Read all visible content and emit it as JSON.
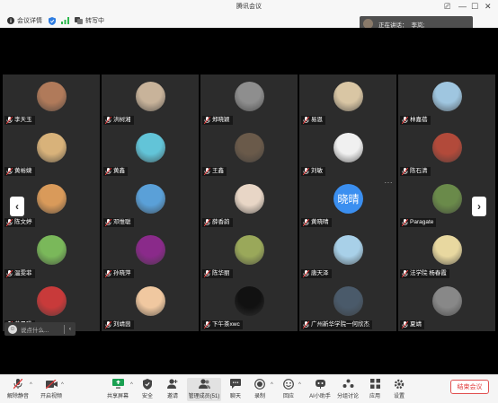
{
  "app_title": "腾讯会议",
  "infobar": {
    "meeting_details": "会议详情",
    "recording": "转写中"
  },
  "speaking": {
    "label": "正在讲话：",
    "speaker": "李岚;"
  },
  "participants": [
    {
      "name": "李天玉"
    },
    {
      "name": "洪树湘"
    },
    {
      "name": "郑晓颖"
    },
    {
      "name": "易恩"
    },
    {
      "name": "林嘉蓓"
    },
    {
      "name": "黄裕婕"
    },
    {
      "name": "黄鑫"
    },
    {
      "name": "王鑫"
    },
    {
      "name": "刘敏"
    },
    {
      "name": "陈石清"
    },
    {
      "name": "陈文婷"
    },
    {
      "name": "邓惟聪"
    },
    {
      "name": "薛香韵"
    },
    {
      "name": "黄晓晴",
      "avatar_text": "晓晴"
    },
    {
      "name": "Paragate"
    },
    {
      "name": "温雯菲"
    },
    {
      "name": "孙晓萍"
    },
    {
      "name": "陈华丽"
    },
    {
      "name": "唐天泽"
    },
    {
      "name": "法学院 杨春霞"
    },
    {
      "name": "黄晨璞"
    },
    {
      "name": "刘靖茵"
    },
    {
      "name": "下午茶xwc"
    },
    {
      "name": "广州新华学院一何欣杰"
    },
    {
      "name": "夏靖"
    }
  ],
  "chat": {
    "placeholder": "说点什么..."
  },
  "toolbar": {
    "mute": "解除静音",
    "video": "开启视频",
    "share": "共享屏幕",
    "security": "安全",
    "invite": "邀请",
    "members": "管理成员(51)",
    "chat": "聊天",
    "record": "录制",
    "reactions": "回应",
    "ai": "AI小助手",
    "breakout": "分组讨论",
    "apps": "应用",
    "settings": "设置",
    "end": "结束会议"
  },
  "colors": {
    "accent": "#3b8ff0",
    "end": "#e03a3a",
    "tile": "#2c2c2c",
    "stage": "#000000"
  }
}
